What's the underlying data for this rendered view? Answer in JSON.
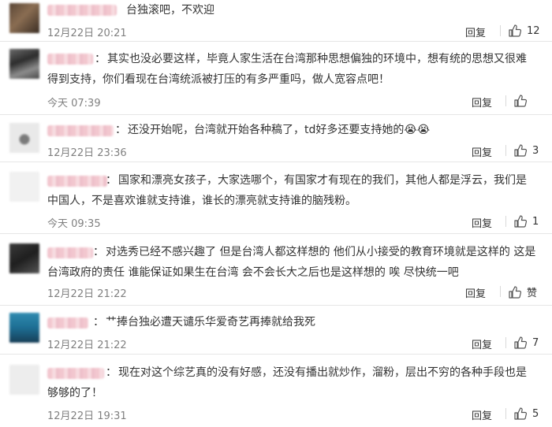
{
  "ui": {
    "reply_label": "回复",
    "like_icon": "thumbs-up-icon"
  },
  "comments": [
    {
      "text": "台独滚吧，不欢迎",
      "time": "12月22日 20:21",
      "likes": "12"
    },
    {
      "text": "其实也没必要这样，毕竟人家生活在台湾那种思想偏独的环境中，想有统的思想又很难得到支持，你们看现在台湾统派被打压的有多严重吗，做人宽容点吧！",
      "time": "今天 07:39",
      "likes": ""
    },
    {
      "text": "还没开始呢，台湾就开始各种稿了，td好多还要支持她的",
      "emoji": "😭😭",
      "time": "12月22日 23:36",
      "likes": "3"
    },
    {
      "text": "国家和漂亮女孩子，大家选哪个，有国家才有现在的我们，其他人都是浮云，我们是中国人，不是喜欢谁就支持谁，谁长的漂亮就支持谁的脑残粉。",
      "time": "今天 09:35",
      "likes": "1"
    },
    {
      "text": "对选秀已经不感兴趣了 但是台湾人都这样想的 他们从小接受的教育环境就是这样的 这是台湾政府的责任 谁能保证如果生在台湾 会不会长大之后也是这样想的 唉 尽快统一吧",
      "time": "12月22日 21:22",
      "likes": "赞"
    },
    {
      "text": "艹捧台独必遭天谴乐华爱奇艺再捧就给我死",
      "time": "12月22日 21:22",
      "likes": "7"
    },
    {
      "text": "现在对这个综艺真的没有好感，还没有播出就炒作，溜粉，层出不穷的各种手段也是够够的了！",
      "time": "12月22日 19:31",
      "likes": "5"
    }
  ]
}
